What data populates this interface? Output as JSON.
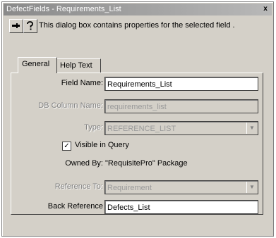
{
  "window": {
    "title": "DefectFields - Requirements_List",
    "close_glyph": "x"
  },
  "toolbar": {
    "pin_icon": "pushpin-icon",
    "help_icon": "help-icon",
    "info_text": "This dialog box contains properties for the selected field ."
  },
  "tabs": [
    {
      "label": "General",
      "active": true
    },
    {
      "label": "Help Text",
      "active": false
    }
  ],
  "form": {
    "field_name_label": "Field Name:",
    "field_name_value": "Requirements_List",
    "db_column_label": "DB Column Name:",
    "db_column_value": "requirements_list",
    "type_label": "Type:",
    "type_value": "REFERENCE_LIST",
    "visible_label": "Visible in Query",
    "visible_checked": true,
    "owned_by_label": "Owned By:",
    "owned_by_value": "\"RequisitePro\" Package",
    "reference_to_label": "Reference To:",
    "reference_to_value": "Requirement",
    "back_reference_label": "Back Reference",
    "back_reference_value": "Defects_List"
  }
}
